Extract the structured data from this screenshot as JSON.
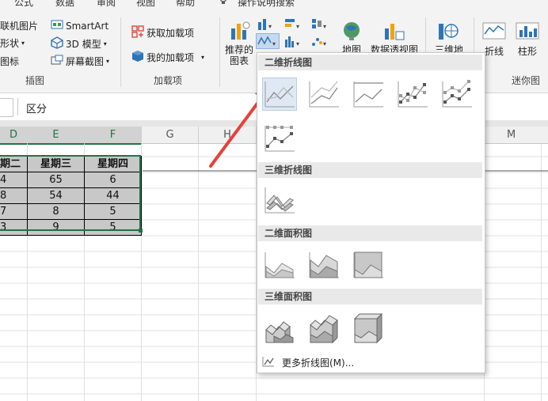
{
  "ribbon": {
    "tabs": [
      "公式",
      "数据",
      "审阅",
      "视图",
      "帮助",
      "操作说明搜索"
    ],
    "illustrations": {
      "online_pictures": "联机图片",
      "shapes": "形状",
      "icons": "图标",
      "smartart": "SmartArt",
      "model_3d": "3D 模型",
      "screenshot": "屏幕截图",
      "group_label": "插图"
    },
    "addins": {
      "get_addins": "获取加载项",
      "my_addins": "我的加载项",
      "group_label": "加载项"
    },
    "charts": {
      "recommended_line1": "推荐的",
      "recommended_line2": "图表",
      "map": "地图",
      "pivot_chart": "数据透视图",
      "map3d": "三维地"
    },
    "sparklines": {
      "line": "折线",
      "column": "柱形",
      "group_label": "迷你图"
    }
  },
  "formula_bar": {
    "content": "区分"
  },
  "sheet": {
    "columns": [
      "D",
      "E",
      "F",
      "G",
      "H",
      "M"
    ],
    "table": {
      "headers": [
        "期二",
        "星期三",
        "星期四"
      ],
      "rows": [
        [
          "4",
          "65",
          "6"
        ],
        [
          "8",
          "54",
          "44"
        ],
        [
          "7",
          "8",
          "5"
        ],
        [
          "3",
          "9",
          "5"
        ]
      ]
    }
  },
  "dropdown": {
    "sec_2d_line": "二维折线图",
    "sec_3d_line": "三维折线图",
    "sec_2d_area": "二维面积图",
    "sec_3d_area": "三维面积图",
    "more_link": "更多折线图(M)..."
  },
  "colors": {
    "accent_green": "#217346",
    "annotation_red": "#e8403a",
    "selection_fill": "#c8c8c8"
  }
}
